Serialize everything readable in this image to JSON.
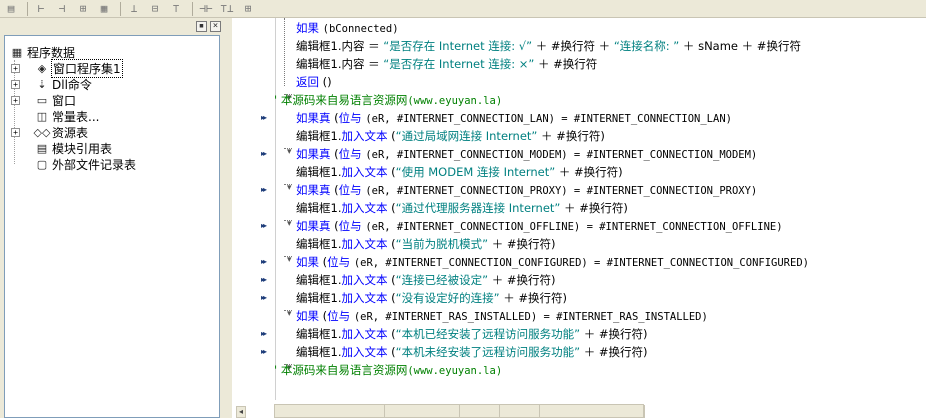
{
  "toolbar": {
    "icons": [
      "align-left-icon",
      "align-center-icon",
      "align-right-icon",
      "distribute-h-icon",
      "distribute-v-icon",
      "align-top-icon",
      "align-middle-icon",
      "align-bottom-icon",
      "same-width-icon",
      "same-height-icon",
      "same-size-icon"
    ],
    "glyphs": [
      "▤",
      "⊢",
      "⊣",
      "⊞",
      "▦",
      "⊥",
      "⊟",
      "⊤",
      "⊣⊢",
      "⊤⊥",
      "⊞"
    ]
  },
  "left_panel": {
    "close_glyph": "×",
    "pin_glyph": "▪",
    "tree": [
      {
        "label": "程序数据",
        "icon": "▦",
        "expander": "",
        "level": 0
      },
      {
        "label": "窗口程序集1",
        "icon": "◈",
        "expander": "+",
        "level": 1
      },
      {
        "label": "Dll命令",
        "icon": "⇣",
        "expander": "+",
        "level": 1
      },
      {
        "label": "窗口",
        "icon": "▭",
        "expander": "+",
        "level": 1
      },
      {
        "label": "常量表...",
        "icon": "◫",
        "expander": "",
        "level": 1
      },
      {
        "label": "资源表",
        "icon": "◇◇",
        "expander": "+",
        "level": 1
      },
      {
        "label": "模块引用表",
        "icon": "▤",
        "expander": "",
        "level": 1
      },
      {
        "label": "外部文件记录表",
        "icon": "▢",
        "expander": "",
        "level": 1
      }
    ]
  },
  "code": {
    "lines": [
      {
        "parts": [
          {
            "t": "如果 ",
            "c": "kw"
          },
          {
            "t": "(bConnected)",
            "c": "obj mono"
          }
        ]
      },
      {
        "parts": [
          {
            "t": "编辑框1.",
            "c": "obj"
          },
          {
            "t": "内容",
            "c": "obj"
          },
          {
            "t": " ＝ ",
            "c": "obj"
          },
          {
            "t": "“是否存在 Internet 连接:  √”",
            "c": "str"
          },
          {
            "t": " ＋ #换行符 ＋ ",
            "c": "obj"
          },
          {
            "t": "“连接名称:  ”",
            "c": "str"
          },
          {
            "t": " ＋ sName ＋ #换行符",
            "c": "obj"
          }
        ]
      },
      {
        "parts": [
          {
            "t": "编辑框1.",
            "c": "obj"
          },
          {
            "t": "内容",
            "c": "obj"
          },
          {
            "t": " ＝ ",
            "c": "obj"
          },
          {
            "t": "“是否存在 Internet 连接:  ×”",
            "c": "str"
          },
          {
            "t": " ＋ #换行符",
            "c": "obj"
          }
        ]
      },
      {
        "parts": [
          {
            "t": "返回 ",
            "c": "kw"
          },
          {
            "t": "()",
            "c": "obj"
          }
        ]
      },
      {
        "parts": [
          {
            "t": "' 本源码来自易语言资源网",
            "c": "cm"
          },
          {
            "t": "(www.eyuyan.la)",
            "c": "cm mono"
          }
        ]
      },
      {
        "parts": [
          {
            "t": "如果真 ",
            "c": "kw"
          },
          {
            "t": "(",
            "c": "obj"
          },
          {
            "t": "位与 ",
            "c": "kw"
          },
          {
            "t": "(eR, #INTERNET_CONNECTION_LAN) = #INTERNET_CONNECTION_LAN)",
            "c": "obj mono"
          }
        ]
      },
      {
        "parts": [
          {
            "t": "编辑框1.",
            "c": "obj"
          },
          {
            "t": "加入文本 ",
            "c": "kw"
          },
          {
            "t": "(",
            "c": "obj"
          },
          {
            "t": "“通过局域网连接 Internet”",
            "c": "str"
          },
          {
            "t": " ＋ #换行符)",
            "c": "obj"
          }
        ]
      },
      {
        "parts": [
          {
            "t": "如果真 ",
            "c": "kw"
          },
          {
            "t": "(",
            "c": "obj"
          },
          {
            "t": "位与 ",
            "c": "kw"
          },
          {
            "t": "(eR, #INTERNET_CONNECTION_MODEM) = #INTERNET_CONNECTION_MODEM)",
            "c": "obj mono"
          }
        ]
      },
      {
        "parts": [
          {
            "t": "编辑框1.",
            "c": "obj"
          },
          {
            "t": "加入文本 ",
            "c": "kw"
          },
          {
            "t": "(",
            "c": "obj"
          },
          {
            "t": "“使用 MODEM 连接 Internet”",
            "c": "str"
          },
          {
            "t": " ＋ #换行符)",
            "c": "obj"
          }
        ]
      },
      {
        "parts": [
          {
            "t": "如果真 ",
            "c": "kw"
          },
          {
            "t": "(",
            "c": "obj"
          },
          {
            "t": "位与 ",
            "c": "kw"
          },
          {
            "t": "(eR, #INTERNET_CONNECTION_PROXY) = #INTERNET_CONNECTION_PROXY)",
            "c": "obj mono"
          }
        ]
      },
      {
        "parts": [
          {
            "t": "编辑框1.",
            "c": "obj"
          },
          {
            "t": "加入文本 ",
            "c": "kw"
          },
          {
            "t": "(",
            "c": "obj"
          },
          {
            "t": "“通过代理服务器连接 Internet”",
            "c": "str"
          },
          {
            "t": " ＋ #换行符)",
            "c": "obj"
          }
        ]
      },
      {
        "parts": [
          {
            "t": "如果真 ",
            "c": "kw"
          },
          {
            "t": "(",
            "c": "obj"
          },
          {
            "t": "位与 ",
            "c": "kw"
          },
          {
            "t": "(eR, #INTERNET_CONNECTION_OFFLINE) = #INTERNET_CONNECTION_OFFLINE)",
            "c": "obj mono"
          }
        ]
      },
      {
        "parts": [
          {
            "t": "编辑框1.",
            "c": "obj"
          },
          {
            "t": "加入文本 ",
            "c": "kw"
          },
          {
            "t": "(",
            "c": "obj"
          },
          {
            "t": "“当前为脱机模式”",
            "c": "str"
          },
          {
            "t": " ＋ #换行符)",
            "c": "obj"
          }
        ]
      },
      {
        "parts": [
          {
            "t": "如果 ",
            "c": "kw"
          },
          {
            "t": "(",
            "c": "obj"
          },
          {
            "t": "位与 ",
            "c": "kw"
          },
          {
            "t": "(eR, #INTERNET_CONNECTION_CONFIGURED) = #INTERNET_CONNECTION_CONFIGURED)",
            "c": "obj mono"
          }
        ]
      },
      {
        "parts": [
          {
            "t": "编辑框1.",
            "c": "obj"
          },
          {
            "t": "加入文本 ",
            "c": "kw"
          },
          {
            "t": "(",
            "c": "obj"
          },
          {
            "t": "“连接已经被设定”",
            "c": "str"
          },
          {
            "t": " ＋ #换行符)",
            "c": "obj"
          }
        ]
      },
      {
        "parts": [
          {
            "t": "编辑框1.",
            "c": "obj"
          },
          {
            "t": "加入文本 ",
            "c": "kw"
          },
          {
            "t": "(",
            "c": "obj"
          },
          {
            "t": "“没有设定好的连接”",
            "c": "str"
          },
          {
            "t": " ＋ #换行符)",
            "c": "obj"
          }
        ]
      },
      {
        "parts": [
          {
            "t": "如果 ",
            "c": "kw"
          },
          {
            "t": "(",
            "c": "obj"
          },
          {
            "t": "位与 ",
            "c": "kw"
          },
          {
            "t": "(eR, #INTERNET_RAS_INSTALLED) = #INTERNET_RAS_INSTALLED)",
            "c": "obj mono"
          }
        ]
      },
      {
        "parts": [
          {
            "t": "编辑框1.",
            "c": "obj"
          },
          {
            "t": "加入文本 ",
            "c": "kw"
          },
          {
            "t": "(",
            "c": "obj"
          },
          {
            "t": "“本机已经安装了远程访问服务功能”",
            "c": "str"
          },
          {
            "t": " ＋ #换行符)",
            "c": "obj"
          }
        ]
      },
      {
        "parts": [
          {
            "t": "编辑框1.",
            "c": "obj"
          },
          {
            "t": "加入文本 ",
            "c": "kw"
          },
          {
            "t": "(",
            "c": "obj"
          },
          {
            "t": "“本机未经安装了远程访问服务功能”",
            "c": "str"
          },
          {
            "t": " ＋ #换行符)",
            "c": "obj"
          }
        ]
      },
      {
        "parts": [
          {
            "t": "' 本源码来自易语言资源网",
            "c": "cm"
          },
          {
            "t": "(www.eyuyan.la)",
            "c": "cm mono"
          }
        ]
      }
    ],
    "arrow_marks": [
      0,
      0,
      0,
      0,
      0,
      1,
      0,
      1,
      0,
      1,
      0,
      1,
      0,
      1,
      1,
      1,
      0,
      1,
      1,
      0
    ],
    "arrow_glyph": "▸▸"
  },
  "colors": {
    "keyword": "#0000ff",
    "string": "#008080",
    "comment": "#008000",
    "panel": "#ece9d8"
  }
}
